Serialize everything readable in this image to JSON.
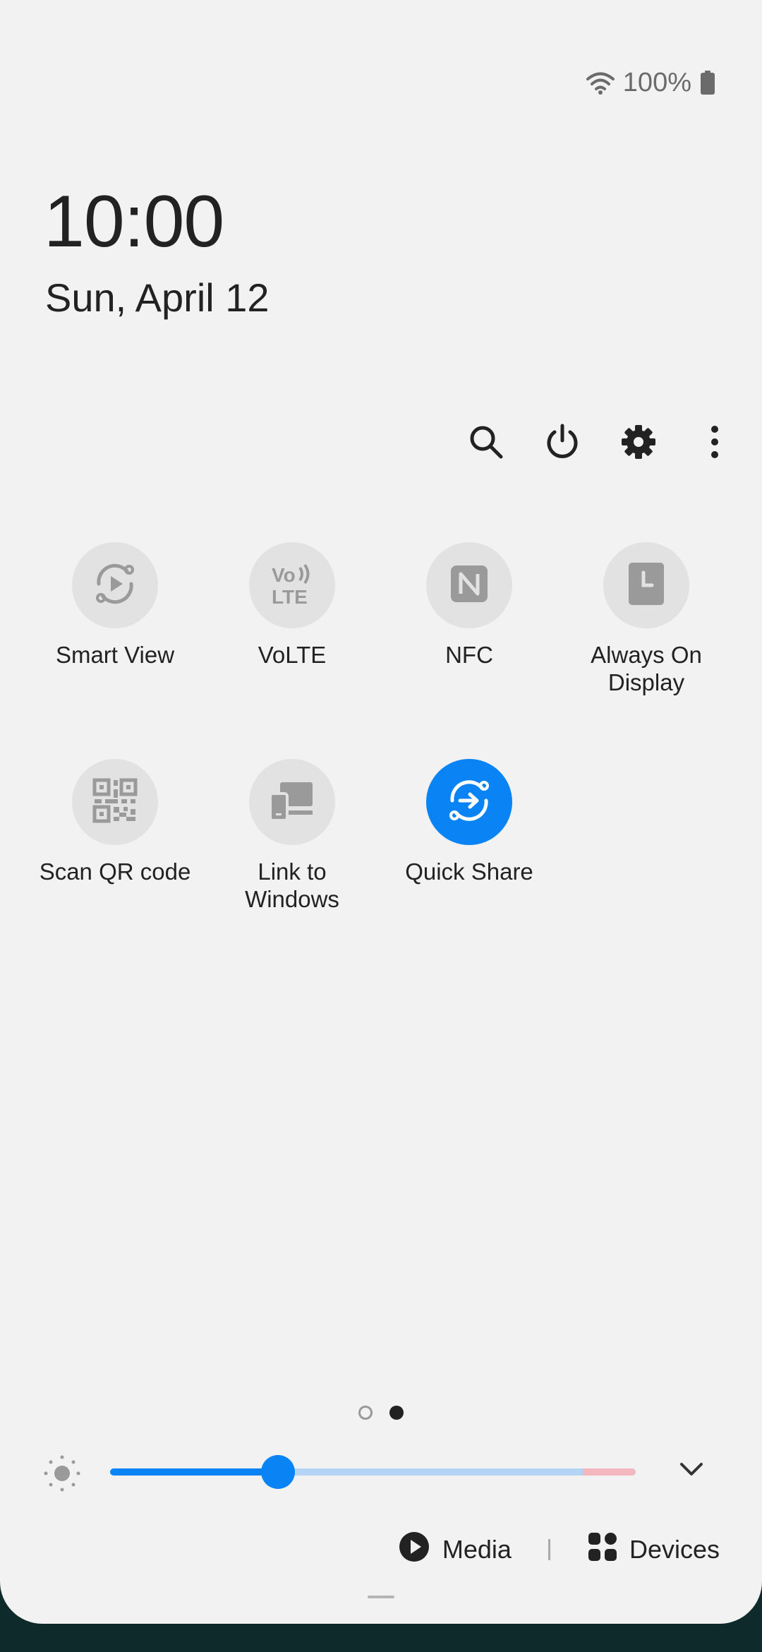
{
  "status": {
    "battery_text": "100%"
  },
  "clock": {
    "time": "10:00",
    "date": "Sun, April 12"
  },
  "toolbar": {
    "search": "search-icon",
    "power": "power-icon",
    "settings": "gear-icon",
    "more": "more-vert-icon"
  },
  "tiles": [
    {
      "label": "Smart View",
      "icon": "smart-view-icon",
      "active": false
    },
    {
      "label": "VoLTE",
      "icon": "volte-icon",
      "active": false
    },
    {
      "label": "NFC",
      "icon": "nfc-icon",
      "active": false
    },
    {
      "label": "Always On\nDisplay",
      "icon": "always-on-display-icon",
      "active": false
    },
    {
      "label": "Scan QR code",
      "icon": "qr-code-icon",
      "active": false
    },
    {
      "label": "Link to\nWindows",
      "icon": "link-to-windows-icon",
      "active": false
    },
    {
      "label": "Quick Share",
      "icon": "quick-share-icon",
      "active": true
    }
  ],
  "pager": {
    "pages": 2,
    "current": 2
  },
  "brightness": {
    "level": 0.32
  },
  "bottom": {
    "media_label": "Media",
    "devices_label": "Devices"
  },
  "colors": {
    "accent": "#0a84f5",
    "panel_bg": "#f2f2f2",
    "tile_bg": "#e2e2e2"
  }
}
